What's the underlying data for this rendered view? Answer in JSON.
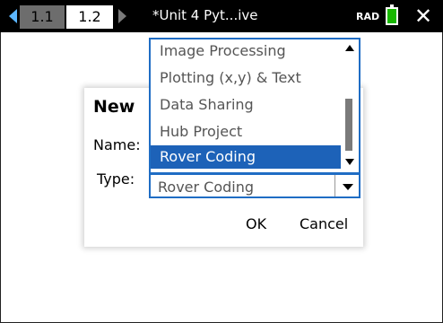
{
  "topbar": {
    "tabs": [
      {
        "label": "1.1"
      },
      {
        "label": "1.2"
      }
    ],
    "doc_title": "*Unit 4 Pyt...ive",
    "mode": "RAD"
  },
  "dialog": {
    "title": "New",
    "name_label": "Name:",
    "name_value": "",
    "type_label": "Type:",
    "type_value": "Rover Coding",
    "ok_label": "OK",
    "cancel_label": "Cancel"
  },
  "dropdown": {
    "items": [
      "Image Processing",
      "Plotting (x,y) & Text",
      "Data Sharing",
      "Hub Project",
      "Rover Coding"
    ],
    "selected_index": 4
  },
  "colors": {
    "accent": "#1f6dc4",
    "selected_bg": "#1d62b8",
    "battery": "#18b800"
  }
}
